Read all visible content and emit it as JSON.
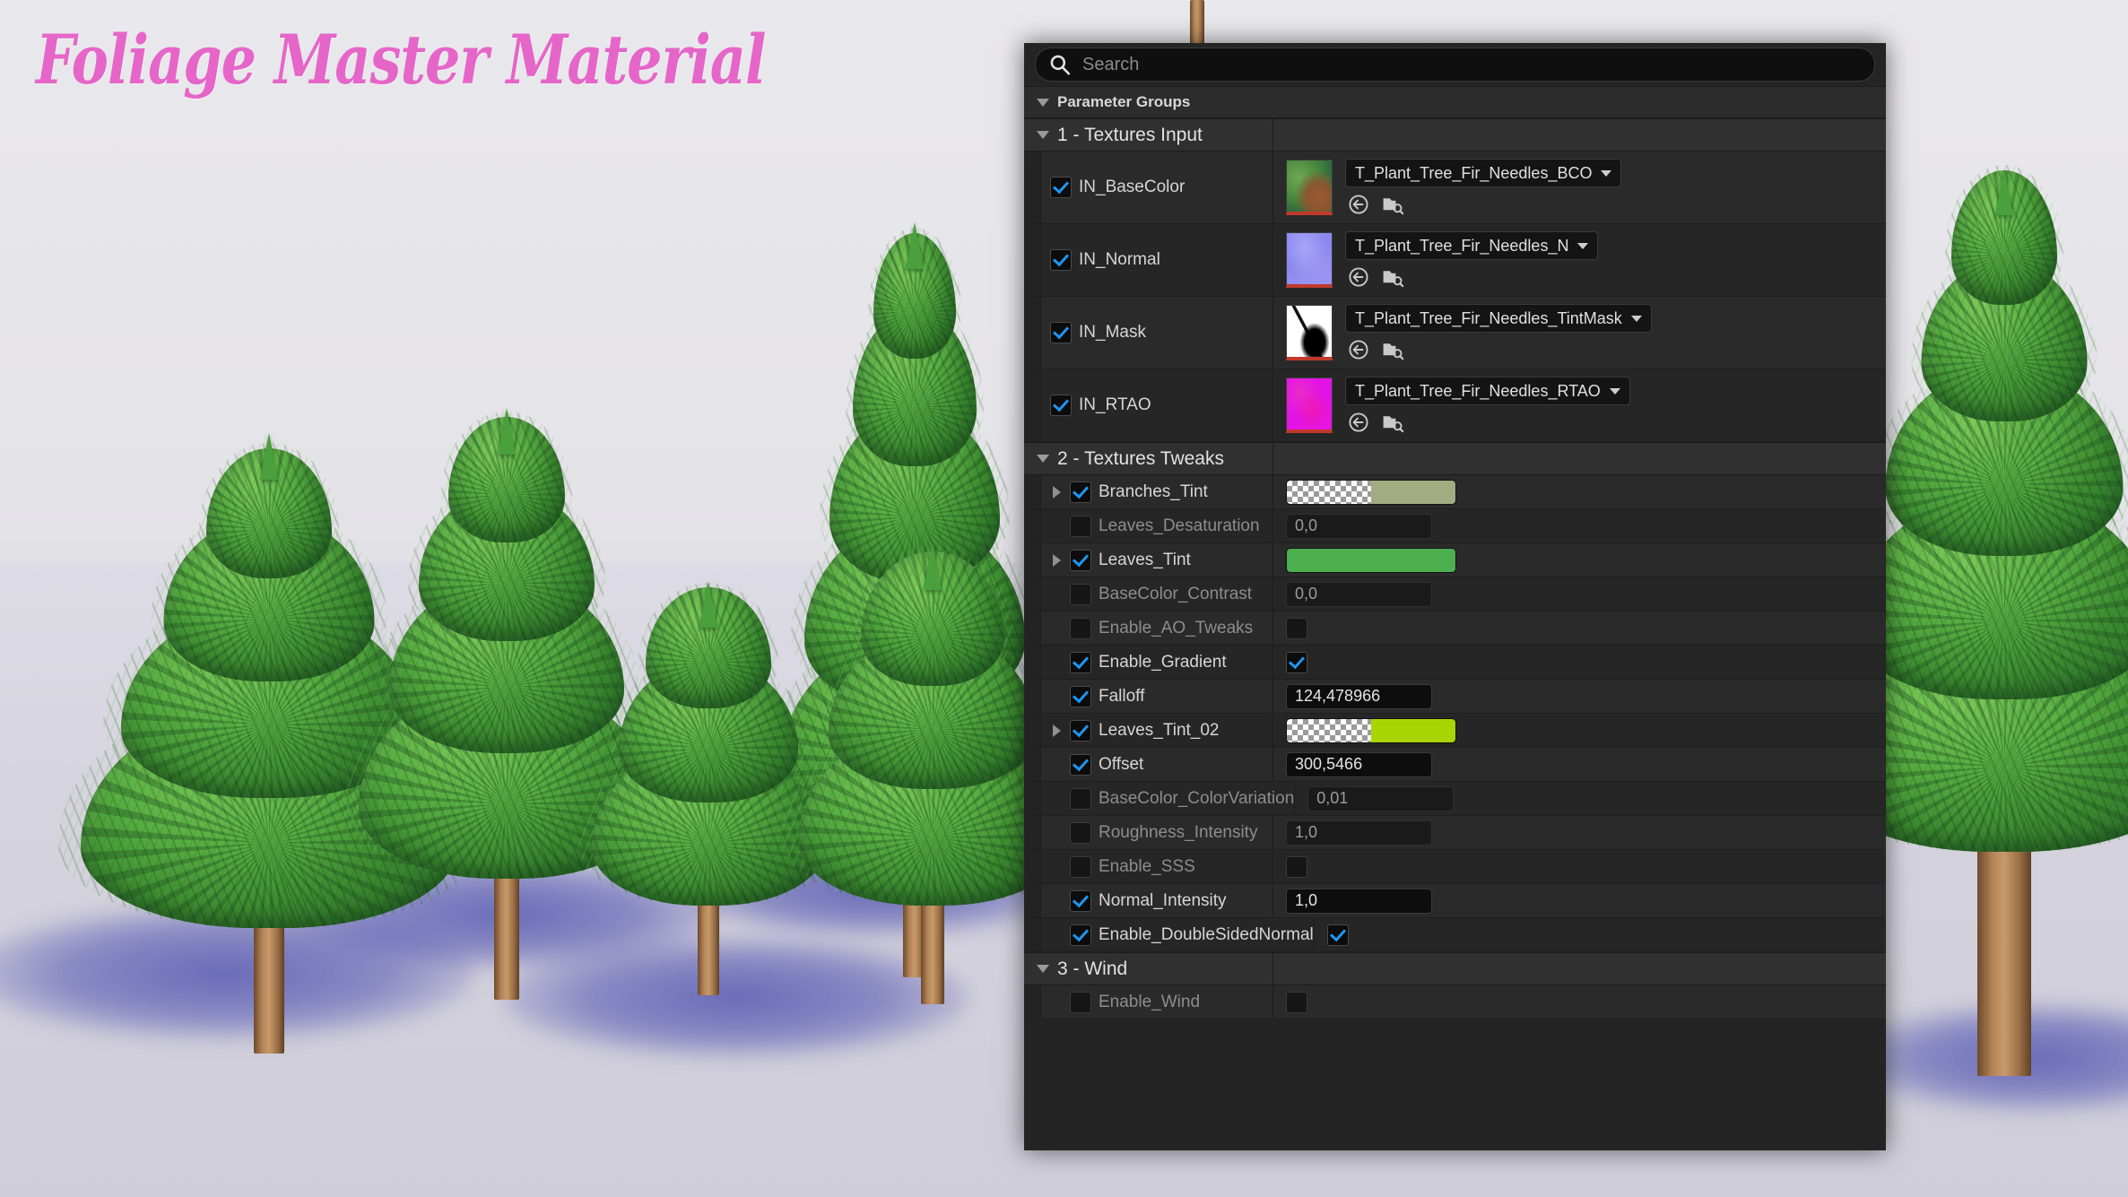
{
  "title": "Foliage Master Material",
  "title_color": "#e566c8",
  "search": {
    "placeholder": "Search",
    "value": "",
    "icon": "search-icon"
  },
  "panel": {
    "parameter_groups_label": "Parameter Groups",
    "groups": [
      {
        "id": "textures-input",
        "label": "1 - Textures Input",
        "expanded": true,
        "rows": [
          {
            "type": "texture",
            "name": "IN_BaseColor",
            "enabled": true,
            "asset": "T_Plant_Tree_Fir_Needles_BCO",
            "thumb": "thumb-basecolor",
            "icons": [
              "use-selected-asset-icon",
              "browse-to-asset-icon"
            ]
          },
          {
            "type": "texture",
            "name": "IN_Normal",
            "enabled": true,
            "asset": "T_Plant_Tree_Fir_Needles_N",
            "thumb": "thumb-normal",
            "icons": [
              "use-selected-asset-icon",
              "browse-to-asset-icon"
            ]
          },
          {
            "type": "texture",
            "name": "IN_Mask",
            "enabled": true,
            "asset": "T_Plant_Tree_Fir_Needles_TintMask",
            "thumb": "thumb-mask",
            "icons": [
              "use-selected-asset-icon",
              "browse-to-asset-icon"
            ]
          },
          {
            "type": "texture",
            "name": "IN_RTAO",
            "enabled": true,
            "asset": "T_Plant_Tree_Fir_Needles_RTAO",
            "thumb": "thumb-rtao",
            "icons": [
              "use-selected-asset-icon",
              "browse-to-asset-icon"
            ]
          }
        ]
      },
      {
        "id": "textures-tweaks",
        "label": "2 - Textures Tweaks",
        "expanded": true,
        "rows": [
          {
            "type": "color",
            "name": "Branches_Tint",
            "enabled": true,
            "expandable": true,
            "color": "#a3ab82",
            "has_alpha_preview": true
          },
          {
            "type": "number",
            "name": "Leaves_Desaturation",
            "enabled": false,
            "expandable": false,
            "value": "0,0"
          },
          {
            "type": "color",
            "name": "Leaves_Tint",
            "enabled": true,
            "expandable": true,
            "color": "#4caf50",
            "has_alpha_preview": false
          },
          {
            "type": "number",
            "name": "BaseColor_Contrast",
            "enabled": false,
            "expandable": false,
            "value": "0,0"
          },
          {
            "type": "bool",
            "name": "Enable_AO_Tweaks",
            "enabled": false,
            "expandable": false,
            "value": false
          },
          {
            "type": "bool",
            "name": "Enable_Gradient",
            "enabled": true,
            "expandable": false,
            "value": true
          },
          {
            "type": "number",
            "name": "Falloff",
            "enabled": true,
            "expandable": false,
            "value": "124,478966"
          },
          {
            "type": "color",
            "name": "Leaves_Tint_02",
            "enabled": true,
            "expandable": true,
            "color": "#a8d604",
            "has_alpha_preview": true
          },
          {
            "type": "number",
            "name": "Offset",
            "enabled": true,
            "expandable": false,
            "value": "300,5466"
          },
          {
            "type": "number",
            "name": "BaseColor_ColorVariation",
            "enabled": false,
            "expandable": false,
            "value": "0,01"
          },
          {
            "type": "number",
            "name": "Roughness_Intensity",
            "enabled": false,
            "expandable": false,
            "value": "1,0"
          },
          {
            "type": "bool",
            "name": "Enable_SSS",
            "enabled": false,
            "expandable": false,
            "value": false
          },
          {
            "type": "number",
            "name": "Normal_Intensity",
            "enabled": true,
            "expandable": false,
            "value": "1,0"
          },
          {
            "type": "bool",
            "name": "Enable_DoubleSidedNormal",
            "enabled": true,
            "expandable": false,
            "value": true
          }
        ]
      },
      {
        "id": "wind",
        "label": "3 - Wind",
        "expanded": true,
        "rows": [
          {
            "type": "bool",
            "name": "Enable_Wind",
            "enabled": false,
            "expandable": false,
            "value": false
          }
        ]
      }
    ]
  }
}
